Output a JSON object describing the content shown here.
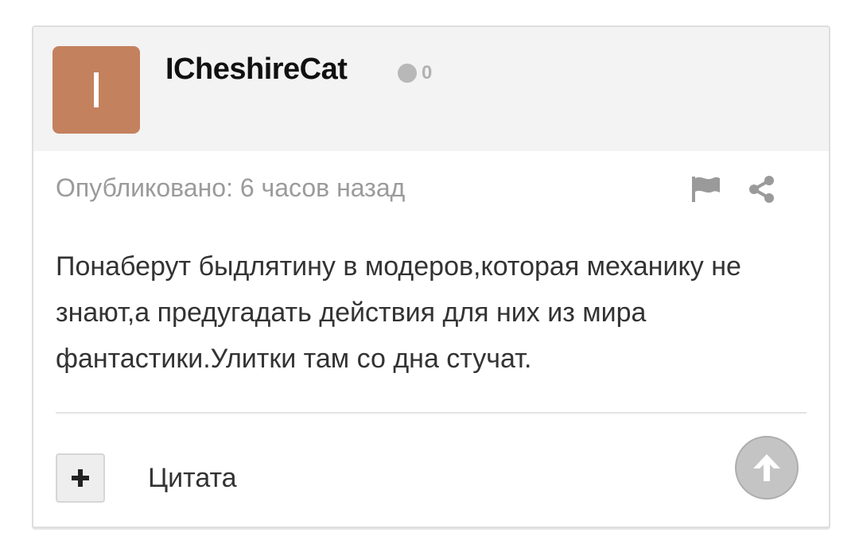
{
  "post": {
    "author": {
      "username": "ICheshireCat",
      "avatar_letter": "I",
      "avatar_color": "#c4815e",
      "reputation": "0"
    },
    "published": "Опубликовано: 6 часов назад",
    "body": "Понаберут быдлятину в модеров,которая механику не знают,а предугадать действия для них из мира фантастики.Улитки там со дна стучат.",
    "actions": {
      "report_icon": "flag-icon",
      "share_icon": "share-icon"
    },
    "footer": {
      "quote_icon": "plus-icon",
      "quote_label": "Цитата",
      "scroll_top_icon": "arrow-up-icon"
    }
  }
}
